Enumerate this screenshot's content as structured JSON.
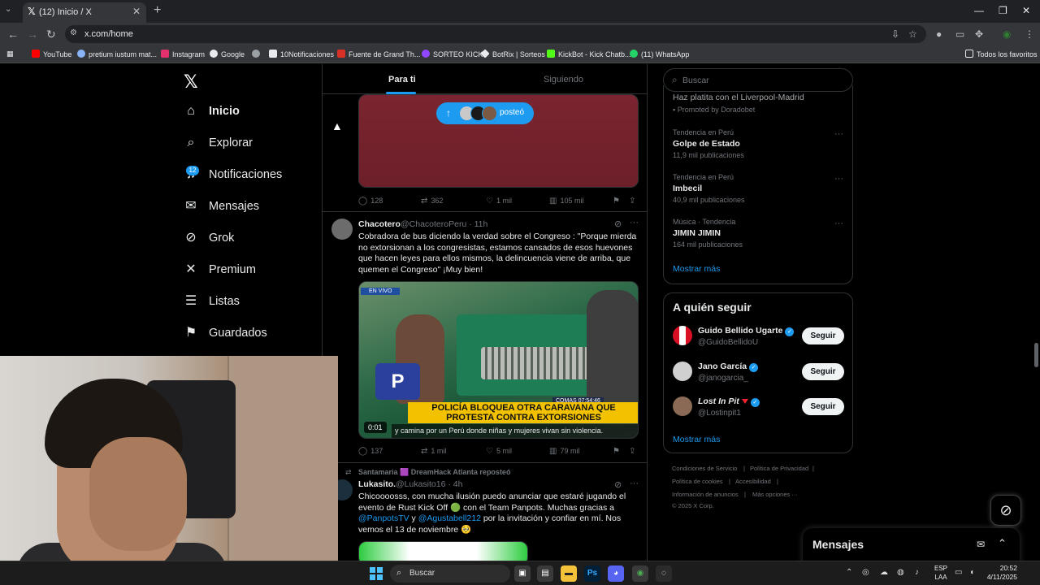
{
  "browser": {
    "tab_title": "(12) Inicio / X",
    "url": "x.com/home",
    "bookmarks": [
      "YouTube",
      "pretium iustum mat...",
      "Instagram",
      "Google",
      "10Notificaciones",
      "Fuente de Grand Th...",
      "SORTEO KICK",
      "BotRix | Sorteos",
      "KickBot - Kick Chatb...",
      "(11) WhatsApp"
    ],
    "all_bookmarks": "Todos los favoritos",
    "bookmark_colors": [
      "#ff0000",
      "#8ab4f8",
      "#e1306c",
      "#8ab4f8",
      "#e8eaed",
      "#e8eaed",
      "#d93025",
      "#9146ff",
      "#e8eaed",
      "#53fc18",
      "#25d366"
    ]
  },
  "sidebar": {
    "badge": "12",
    "items": [
      {
        "label": "Inicio",
        "icon": "home-icon"
      },
      {
        "label": "Explorar",
        "icon": "search-icon"
      },
      {
        "label": "Notificaciones",
        "icon": "bell-icon"
      },
      {
        "label": "Mensajes",
        "icon": "mail-icon"
      },
      {
        "label": "Grok",
        "icon": "grok-icon"
      },
      {
        "label": "Premium",
        "icon": "x-icon"
      },
      {
        "label": "Listas",
        "icon": "list-icon"
      },
      {
        "label": "Guardados",
        "icon": "bookmark-icon"
      }
    ]
  },
  "feed": {
    "tabs": [
      "Para ti",
      "Siguiendo"
    ],
    "posted_pill": "posteó",
    "tweet1": {
      "replies": "128",
      "reposts": "362",
      "likes": "1 mil",
      "views": "105 mil"
    },
    "tweet2": {
      "name": "Chacotero",
      "handle": "@ChacoteroPeru · 11h",
      "text": "Cobradora de bus diciendo la verdad sobre el Congreso : \"Porque mierda no extorsionan a los congresistas, estamos cansados de esos huevones que hacen leyes para ellos mismos, la delincuencia viene de arriba, que quemen el Congreso\" ¡Muy bien!",
      "video_live": "EN VIVO",
      "video_headline": "POLICÍA BLOQUEA OTRA CARAVANA QUE PROTESTA CONTRA EXTORSIONES",
      "video_clock": "COMAS 07:54:46",
      "video_caption": "y camina por un Perú donde niñas y mujeres vivan sin violencia.",
      "duration": "0:01",
      "replies": "137",
      "reposts": "1 mil",
      "likes": "5 mil",
      "views": "79 mil"
    },
    "tweet3": {
      "repost_line": "Santamaria 🟪 DreamHack Atlanta reposteó",
      "name": "Lukasito.",
      "handle": "@Lukasito16 · 4h",
      "text_part1": "Chicoooosss, con mucha ilusión puedo anunciar que estaré jugando el evento de Rust Kick Off 🟢 con el Team Panpots. Muchas gracias a ",
      "mention1": "@PanpotsTV",
      "text_part2": " y ",
      "mention2": "@Agustabell212",
      "text_part3": " por la invitación y confiar en mí. Nos vemos el 13 de noviembre 🥺"
    }
  },
  "right": {
    "search_placeholder": "Buscar",
    "promo_title": "Haz platita con el Liverpool-Madrid",
    "promo_by": "Promoted by Doradobet",
    "trends": [
      {
        "meta": "Tendencia en Perú",
        "name": "Golpe de Estado",
        "count": "11,9 mil publicaciones"
      },
      {
        "meta": "Tendencia en Perú",
        "name": "Imbecil",
        "count": "40,9 mil publicaciones"
      },
      {
        "meta": "Música · Tendencia",
        "name": "JIMIN JIMIN",
        "count": "164 mil publicaciones"
      }
    ],
    "show_more": "Mostrar más",
    "follow_title": "A quién seguir",
    "follow": [
      {
        "name": "Guido Bellido Ugarte",
        "handle": "@GuidoBellidoU",
        "button": "Seguir"
      },
      {
        "name": "Jano García",
        "handle": "@janogarcia_",
        "button": "Seguir"
      },
      {
        "name": "Lost In Pit",
        "handle": "@Lostinpit1",
        "button": "Seguir"
      }
    ],
    "follow_show_more": "Mostrar más",
    "footer": [
      "Condiciones de Servicio",
      "|",
      "Política de Privacidad",
      "|",
      "Política de cookies",
      "|",
      "Accesibilidad",
      "|",
      "Información de anuncios",
      "|",
      "Más opciones ···",
      "© 2025 X Corp."
    ],
    "messages_drawer": "Mensajes"
  },
  "taskbar": {
    "search": "Buscar",
    "lang1": "ESP",
    "lang2": "LAA",
    "time": "20:52",
    "date": "4/11/2025"
  }
}
